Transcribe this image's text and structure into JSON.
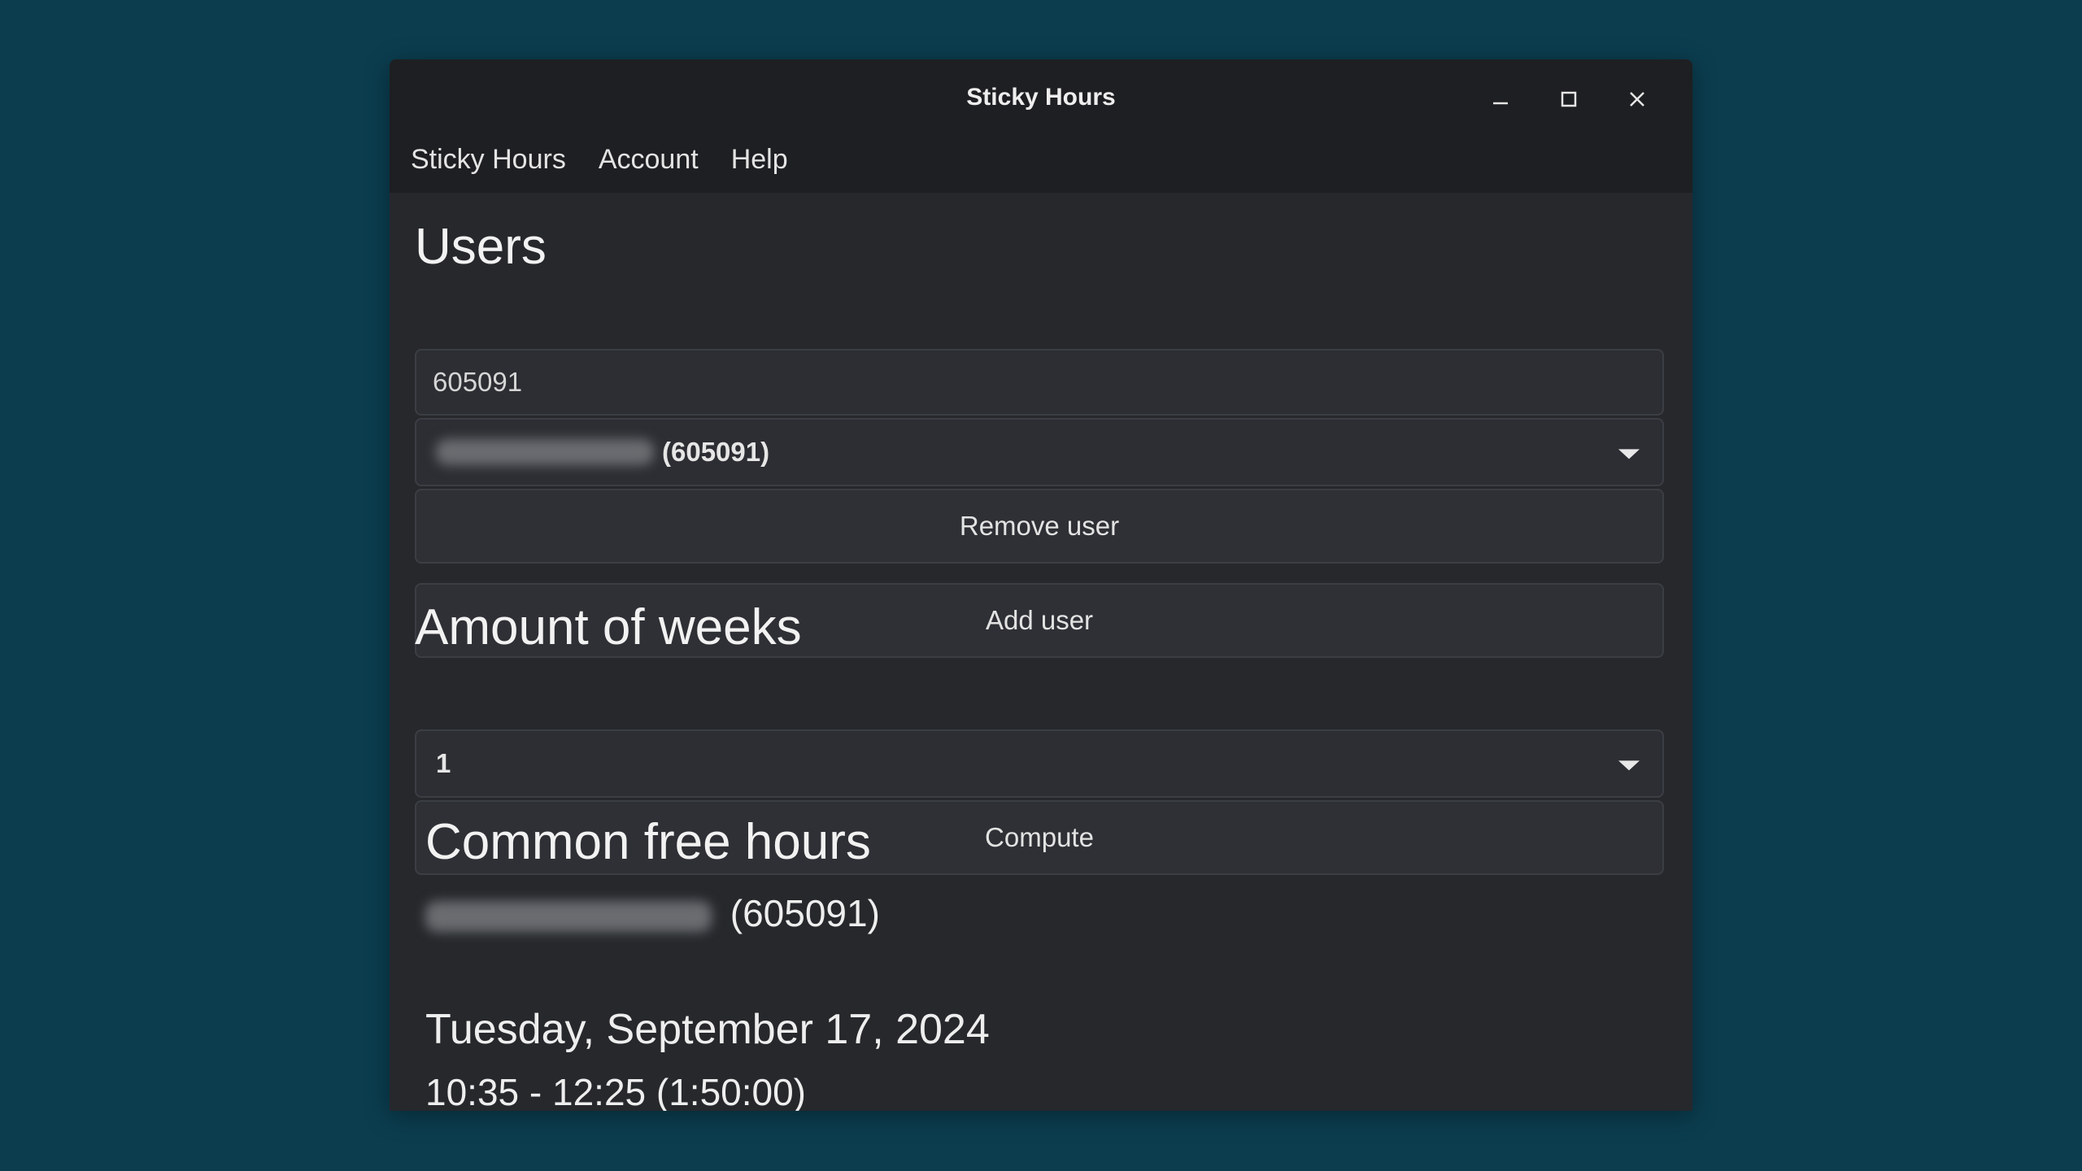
{
  "window": {
    "title": "Sticky Hours"
  },
  "menu": [
    "Sticky Hours",
    "Account",
    "Help"
  ],
  "users": {
    "heading": "Users",
    "input_value": "605091",
    "selected_user_id": "(605091)",
    "remove_button": "Remove user",
    "add_button": "Add user"
  },
  "weeks": {
    "heading": "Amount of weeks",
    "selected": "1",
    "compute_button": "Compute"
  },
  "results": {
    "heading": "Common free hours",
    "user_id": "(605091)",
    "date": "Tuesday, September 17, 2024",
    "slot": "10:35 - 12:25 (1:50:00)"
  },
  "colors": {
    "desktop": "#0b3d4f",
    "window": "#26282c",
    "titlebar": "#1e1f22",
    "field": "#2c2e33"
  },
  "icons": [
    "minimize-icon",
    "maximize-icon",
    "close-icon",
    "chevron-down-icon"
  ]
}
